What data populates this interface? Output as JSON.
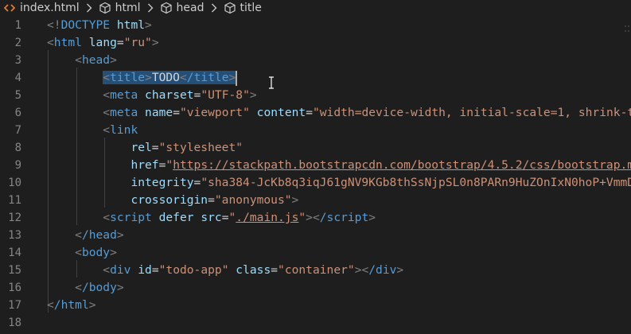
{
  "breadcrumb": {
    "file": "index.html",
    "items": [
      "html",
      "head",
      "title"
    ]
  },
  "colors": {
    "background": "#1e1e1e",
    "tag": "#569cd6",
    "attribute": "#9cdcfe",
    "string": "#ce9178",
    "punctuation": "#808080",
    "text": "#d4d4d4",
    "selection": "#264f78",
    "line_number": "#858585"
  },
  "editor": {
    "line_numbers": [
      "1",
      "2",
      "3",
      "4",
      "5",
      "6",
      "7",
      "8",
      "9",
      "10",
      "11",
      "12",
      "13",
      "14",
      "15",
      "16",
      "17",
      "18"
    ],
    "lines": {
      "l1": {
        "punc_open": "<!",
        "tag": "DOCTYPE",
        "rest": " html",
        "punc_close": ">"
      },
      "l2": {
        "tag": "html",
        "attr": "lang",
        "eq": "=",
        "val": "\"ru\""
      },
      "l3": {
        "tag": "head"
      },
      "l4": {
        "tag_open": "title",
        "text": "TODO",
        "tag_close": "/title"
      },
      "l5": {
        "tag": "meta",
        "attr": "charset",
        "val": "\"UTF-8\""
      },
      "l6": {
        "tag": "meta",
        "attr1": "name",
        "val1": "\"viewport\"",
        "attr2": "content",
        "val2": "\"width=device-width, initial-scale=1, shrink-t"
      },
      "l7": {
        "tag": "link"
      },
      "l8": {
        "attr": "rel",
        "val": "\"stylesheet\""
      },
      "l9": {
        "attr": "href",
        "q": "\"",
        "link": "https://stackpath.bootstrapcdn.com/bootstrap/4.5.2/css/bootstrap.m"
      },
      "l10": {
        "attr": "integrity",
        "val": "\"sha384-JcKb8q3iqJ61gNV9KGb8thSsNjpSL0n8PARn9HuZOnIxN0hoP+VmmD"
      },
      "l11": {
        "attr": "crossorigin",
        "val": "\"anonymous\""
      },
      "l12": {
        "tag": "script",
        "attr1": "defer",
        "attr2": "src",
        "q": "\"",
        "link": "./main.js",
        "q2": "\"",
        "tag_close": "/script"
      },
      "l13": {
        "tag": "/head"
      },
      "l14": {
        "tag": "body"
      },
      "l15": {
        "tag": "div",
        "attr1": "id",
        "val1": "\"todo-app\"",
        "attr2": "class",
        "val2": "\"container\"",
        "tag_close": "/div"
      },
      "l16": {
        "tag": "/body"
      },
      "l17": {
        "tag": "/html"
      }
    }
  }
}
